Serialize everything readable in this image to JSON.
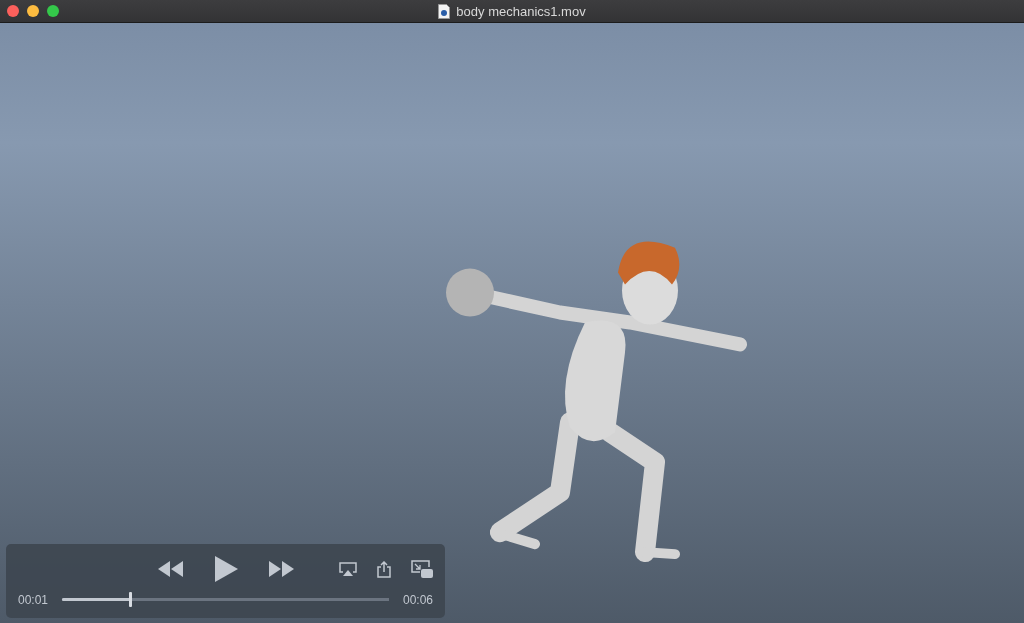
{
  "window": {
    "title": "body mechanics1.mov"
  },
  "controls": {
    "current_time": "00:01",
    "duration": "00:06",
    "level": 0.21
  }
}
